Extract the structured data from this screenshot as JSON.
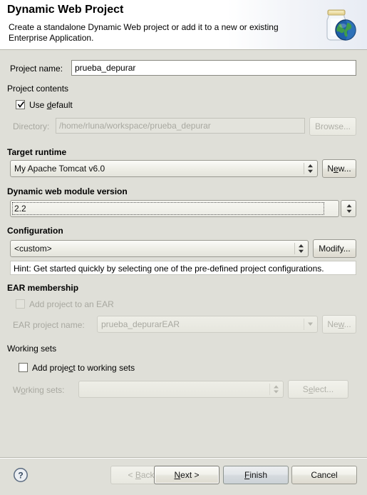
{
  "header": {
    "title": "Dynamic Web Project",
    "description": "Create a standalone Dynamic Web project or add it to a new or existing Enterprise Application.",
    "icon": "war-jar-globe-icon"
  },
  "project_name": {
    "label": "Project name:",
    "value": "prueba_depurar"
  },
  "project_contents": {
    "group_label": "Project contents",
    "use_default": {
      "label_before": "Use ",
      "mnemonic": "d",
      "label_after": "efault",
      "checked": true
    },
    "directory": {
      "label": "Directory:",
      "value": "/home/rluna/workspace/prueba_depurar",
      "enabled": false
    },
    "browse_button": {
      "label": "Browse...",
      "enabled": false
    }
  },
  "target_runtime": {
    "group_label": "Target runtime",
    "selected": "My Apache Tomcat v6.0",
    "new_button": {
      "label_before": "N",
      "mnemonic": "e",
      "label_after": "w..."
    }
  },
  "dynamic_web_module_version": {
    "group_label": "Dynamic web module version",
    "selected": "2.2",
    "focused": true
  },
  "configuration": {
    "group_label": "Configuration",
    "selected": "<custom>",
    "modify_button": {
      "label": "Modify..."
    },
    "hint": "Hint: Get started quickly by selecting one of the pre-defined project configurations."
  },
  "ear_membership": {
    "group_label": "EAR membership",
    "add_to_ear": {
      "label": "Add project to an EAR",
      "checked": false,
      "enabled": false
    },
    "ear_project_name": {
      "label": "EAR project name:",
      "value": "prueba_depurarEAR",
      "enabled": false
    },
    "new_button": {
      "label_before": "Ne",
      "mnemonic": "w",
      "label_after": "...",
      "enabled": false
    }
  },
  "working_sets": {
    "group_label": "Working sets",
    "add_to_working_sets": {
      "label_before": "Add proje",
      "mnemonic": "c",
      "label_after": "t to working sets",
      "checked": false
    },
    "working_sets_combo": {
      "label_before": "W",
      "mnemonic": "o",
      "label_after": "rking sets:",
      "value": "",
      "enabled": false
    },
    "select_button": {
      "label_before": "S",
      "mnemonic": "e",
      "label_after": "lect...",
      "enabled": false
    }
  },
  "footer": {
    "help_icon": "help-question-icon",
    "back_button": {
      "label_before": "< ",
      "mnemonic": "B",
      "label_after": "ack",
      "enabled": false
    },
    "next_button": {
      "label_before": "",
      "mnemonic": "N",
      "label_after": "ext >",
      "focused": true
    },
    "finish_button": {
      "label_before": "",
      "mnemonic": "F",
      "label_after": "inish",
      "default": true
    },
    "cancel_button": {
      "label": "Cancel"
    }
  },
  "colors": {
    "dialog_background": "#dfdfd8",
    "header_background": "#ffffff",
    "field_background": "#ffffff",
    "disabled_text": "#a8a8a0",
    "border": "#9a9a92"
  }
}
